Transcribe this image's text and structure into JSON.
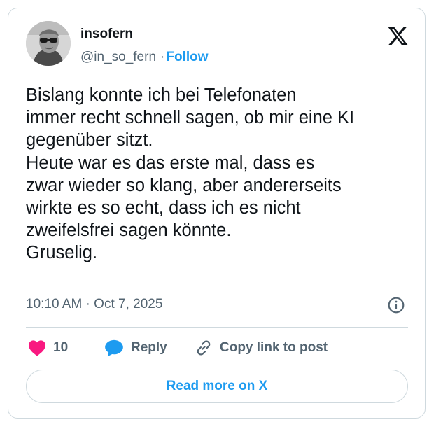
{
  "author": {
    "name": "insofern",
    "handle": "@in_so_fern",
    "separator": "·",
    "follow_label": "Follow"
  },
  "icons": {
    "brand": "x-logo-icon",
    "info": "info-icon",
    "like": "heart-icon",
    "reply": "speech-bubble-icon",
    "copy": "link-icon"
  },
  "tweet": {
    "lines": [
      "Bislang konnte ich bei Telefonaten",
      "immer recht schnell sagen, ob mir eine KI",
      "gegenüber sitzt.",
      "Heute war es das erste mal, dass es",
      "zwar wieder so klang, aber andererseits",
      "wirkte es so echt, dass ich es nicht",
      "zweifelsfrei sagen könnte.",
      "Gruselig."
    ],
    "timestamp": "10:10 AM · Oct 7, 2025"
  },
  "actions": {
    "like_count": "10",
    "reply_label": "Reply",
    "copy_label": "Copy link to post"
  },
  "read_more_label": "Read more on X",
  "colors": {
    "accent": "#1d9bf0",
    "like": "#f91880",
    "text": "#0f1419",
    "secondary": "#536471",
    "border": "#cfd9de"
  }
}
